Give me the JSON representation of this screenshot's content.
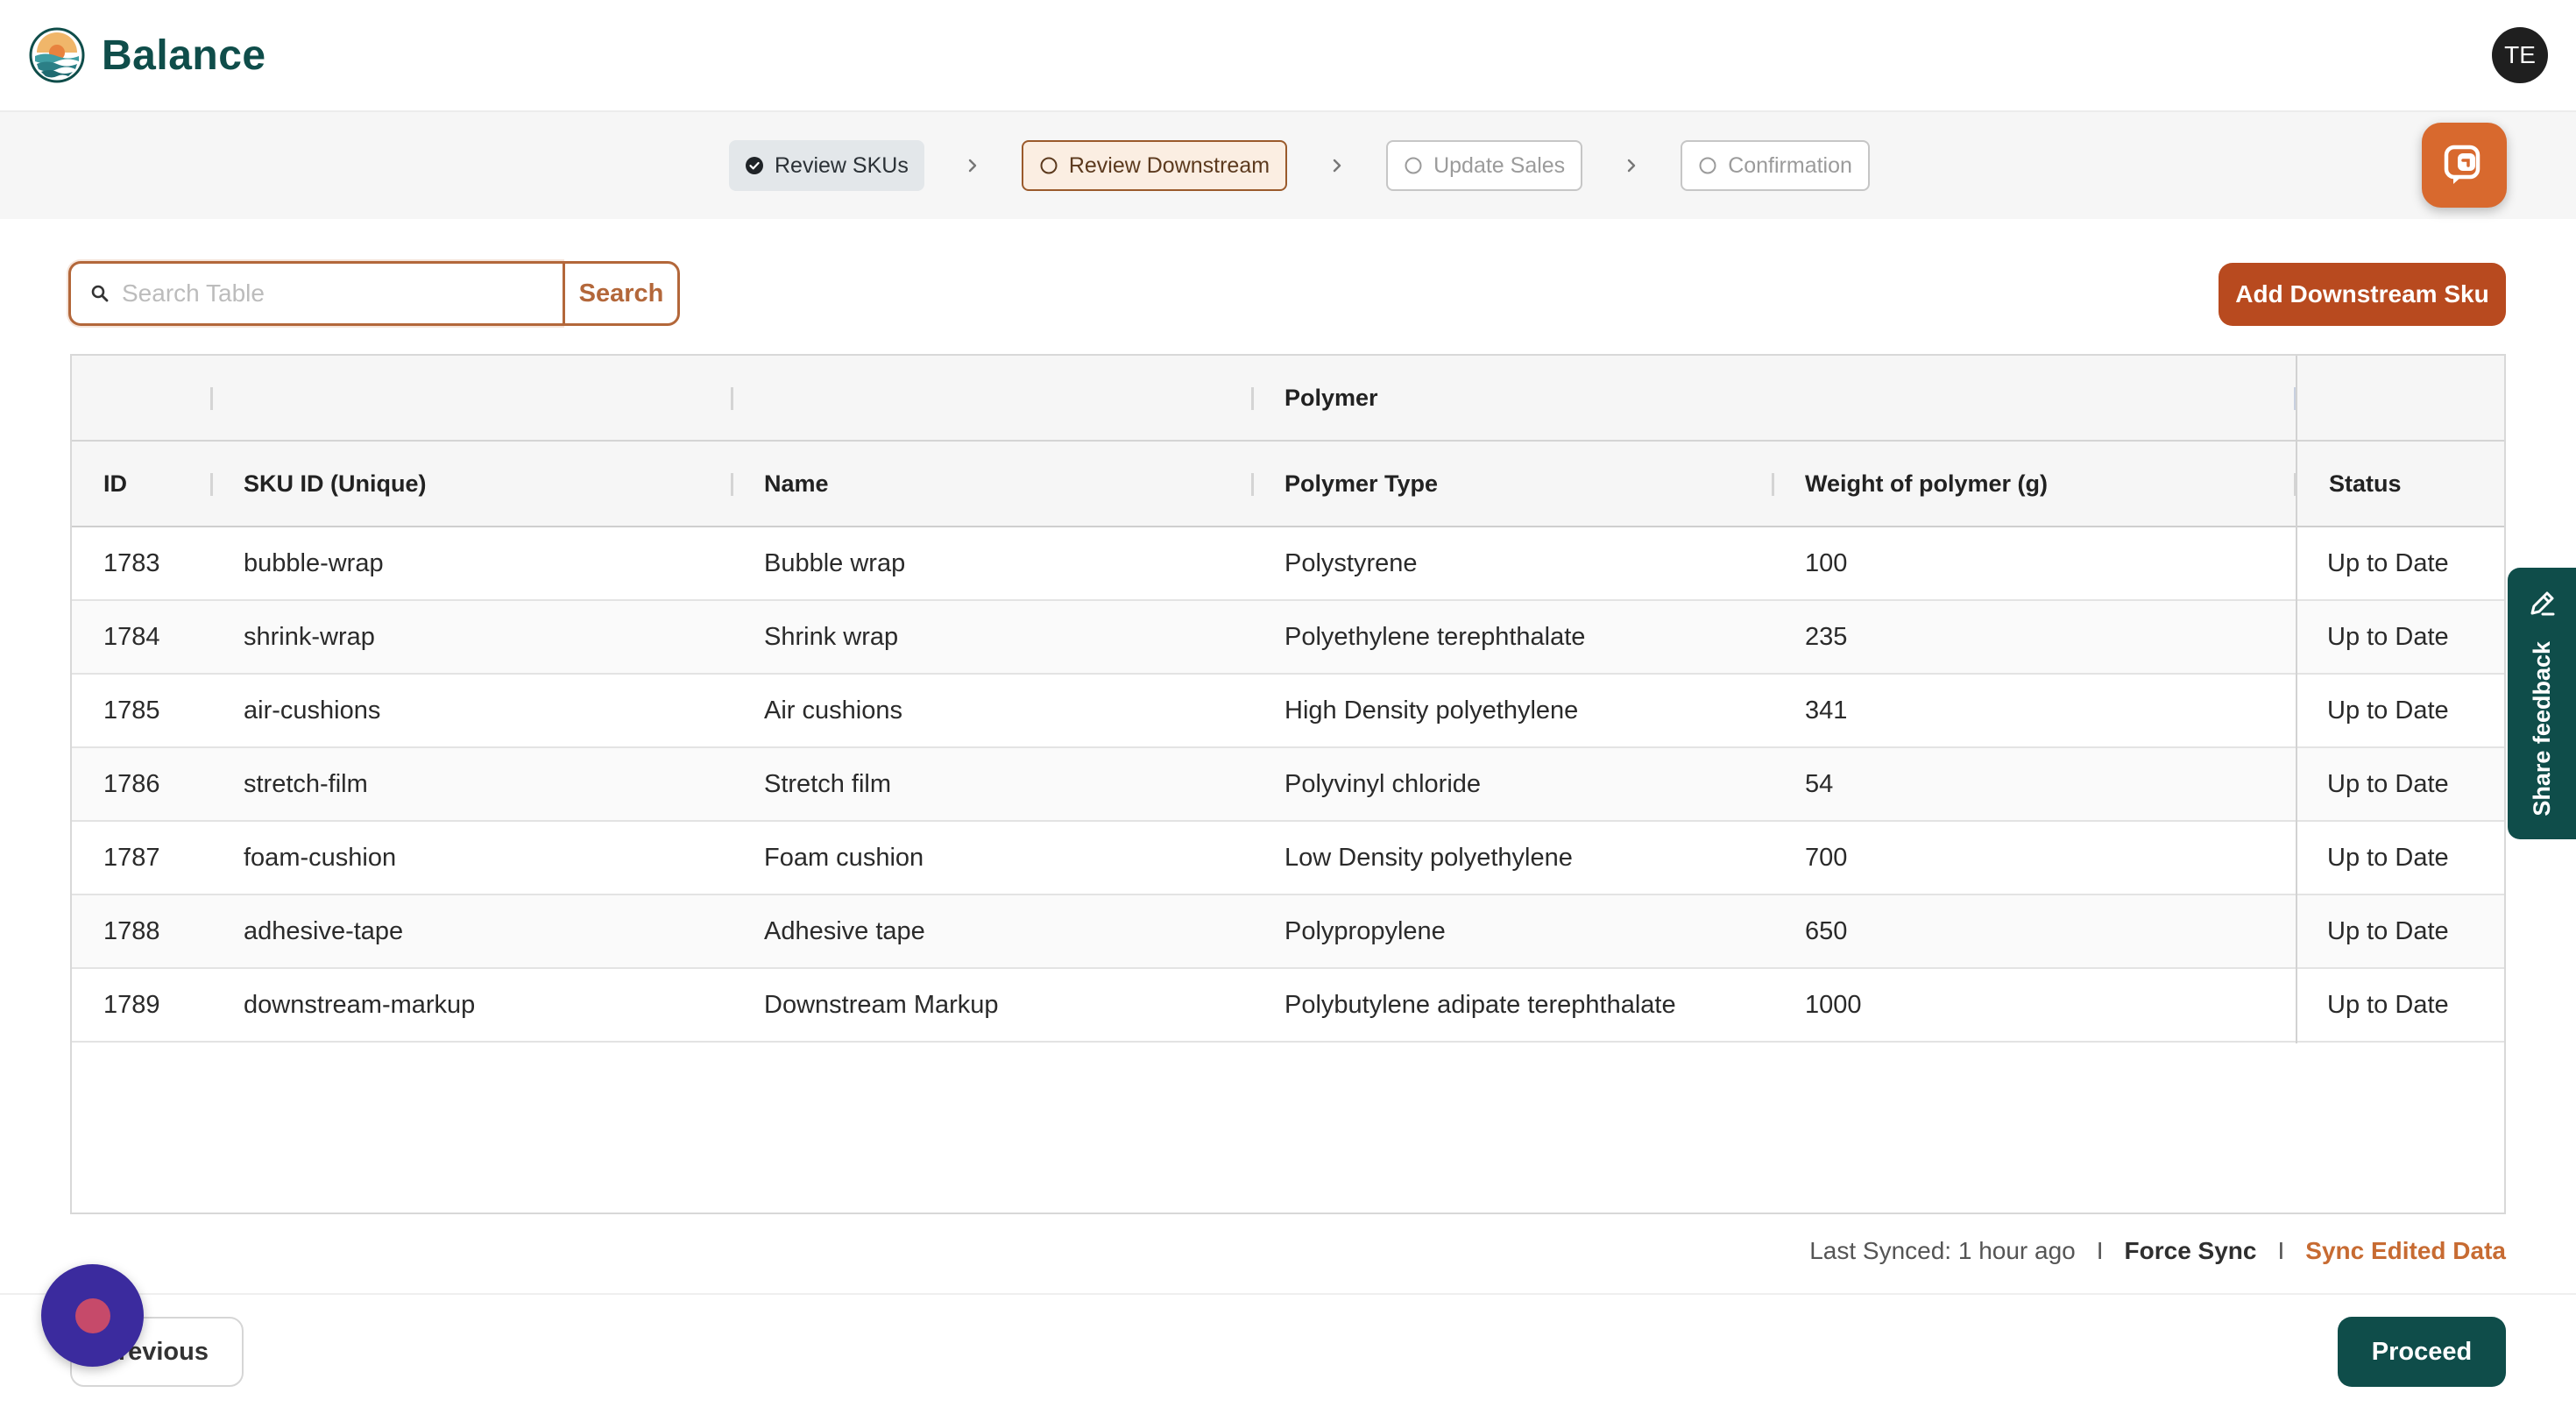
{
  "app": {
    "name": "Balance",
    "user_initials": "TE"
  },
  "stepper": {
    "steps": [
      {
        "label": "Review SKUs",
        "state": "done"
      },
      {
        "label": "Review Downstream",
        "state": "active"
      },
      {
        "label": "Update Sales",
        "state": "pending"
      },
      {
        "label": "Confirmation",
        "state": "pending"
      }
    ]
  },
  "toolbar": {
    "search_placeholder": "Search Table",
    "search_value": "",
    "search_label": "Search",
    "add_label": "Add Downstream Sku"
  },
  "table": {
    "group_header": "Polymer",
    "columns": [
      "ID",
      "SKU ID (Unique)",
      "Name",
      "Polymer Type",
      "Weight of polymer (g)",
      "Status"
    ],
    "rows": [
      {
        "id": "1783",
        "sku": "bubble-wrap",
        "name": "Bubble wrap",
        "polymer_type": "Polystyrene",
        "weight": "100",
        "status": "Up to Date"
      },
      {
        "id": "1784",
        "sku": "shrink-wrap",
        "name": "Shrink wrap",
        "polymer_type": "Polyethylene terephthalate",
        "weight": "235",
        "status": "Up to Date"
      },
      {
        "id": "1785",
        "sku": "air-cushions",
        "name": "Air cushions",
        "polymer_type": "High Density polyethylene",
        "weight": "341",
        "status": "Up to Date"
      },
      {
        "id": "1786",
        "sku": "stretch-film",
        "name": "Stretch film",
        "polymer_type": "Polyvinyl chloride",
        "weight": "54",
        "status": "Up to Date"
      },
      {
        "id": "1787",
        "sku": "foam-cushion",
        "name": "Foam cushion",
        "polymer_type": "Low Density polyethylene",
        "weight": "700",
        "status": "Up to Date"
      },
      {
        "id": "1788",
        "sku": "adhesive-tape",
        "name": "Adhesive tape",
        "polymer_type": "Polypropylene",
        "weight": "650",
        "status": "Up to Date"
      },
      {
        "id": "1789",
        "sku": "downstream-markup",
        "name": "Downstream Markup",
        "polymer_type": "Polybutylene adipate terephthalate",
        "weight": "1000",
        "status": "Up to Date"
      }
    ]
  },
  "sync": {
    "last_synced": "Last Synced: 1 hour ago",
    "separator": "I",
    "force_sync": "Force Sync",
    "sync_edited": "Sync Edited Data"
  },
  "footer": {
    "previous_label": "revious",
    "proceed_label": "Proceed"
  },
  "feedback": {
    "label": "Share feedback"
  },
  "colors": {
    "brand_teal": "#0f4d4a",
    "accent_orange": "#b84a1f",
    "chat_orange": "#d8692e",
    "record_purple": "#3b2b9e"
  },
  "icons": {
    "logo": "balance-logo",
    "step_done": "check-circle-icon",
    "step_pending": "circle-icon",
    "chevron": "chevron-right-icon",
    "chat": "chat-bubble-icon",
    "search": "search-icon",
    "feedback": "pencil-icon"
  }
}
